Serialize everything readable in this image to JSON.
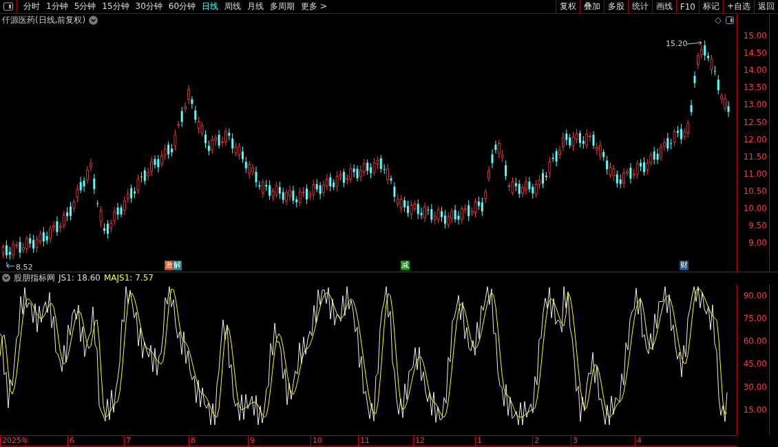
{
  "toolbar": {
    "periods": [
      {
        "label": "分时",
        "selected": false
      },
      {
        "label": "1分钟",
        "selected": false
      },
      {
        "label": "5分钟",
        "selected": false
      },
      {
        "label": "15分钟",
        "selected": false
      },
      {
        "label": "30分钟",
        "selected": false
      },
      {
        "label": "60分钟",
        "selected": false
      },
      {
        "label": "日线",
        "selected": true
      },
      {
        "label": "周线",
        "selected": false
      },
      {
        "label": "月线",
        "selected": false
      },
      {
        "label": "多周期",
        "selected": false
      },
      {
        "label": "更多 >",
        "selected": false
      }
    ],
    "buttons": [
      "复权",
      "叠加",
      "多股",
      "统计",
      "画线",
      "F10",
      "标记",
      "+自选",
      "返回"
    ]
  },
  "main_chart": {
    "title": "仟源医药(日线,前复权)",
    "high_label": "15.20",
    "low_label": "8.52",
    "y_ticks": [
      "15.00",
      "14.50",
      "14.00",
      "13.50",
      "13.00",
      "12.50",
      "12.00",
      "11.50",
      "11.00",
      "10.50",
      "10.00",
      "9.50",
      "9.00"
    ],
    "events": [
      {
        "text": "激",
        "color": "#c0501a"
      },
      {
        "text": "解",
        "color": "#10808a"
      },
      {
        "text": "减",
        "color": "#108a10"
      },
      {
        "text": "财",
        "color": "#1a4f8a"
      }
    ]
  },
  "indicator": {
    "name": "股朋指标网",
    "js1": "JS1: 18.60",
    "majs1": "MAJS1: 7.57",
    "y_ticks": [
      "90.00",
      "75.00",
      "60.00",
      "45.00",
      "30.00",
      "15.00"
    ]
  },
  "date_axis": [
    {
      "label": "2025年"
    },
    {
      "label": "6"
    },
    {
      "label": "7"
    },
    {
      "label": "8"
    },
    {
      "label": "9"
    },
    {
      "label": "10"
    },
    {
      "label": "11"
    },
    {
      "label": "12"
    },
    {
      "label": "1"
    },
    {
      "label": "2"
    },
    {
      "label": "3"
    },
    {
      "label": "4"
    }
  ]
}
